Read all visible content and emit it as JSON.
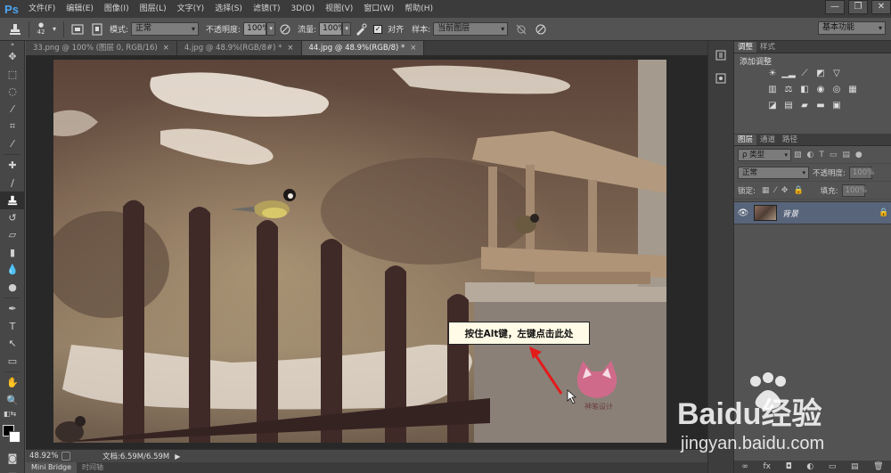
{
  "app": {
    "logo": "Ps",
    "menu": [
      "文件(F)",
      "编辑(E)",
      "图像(I)",
      "图层(L)",
      "文字(Y)",
      "选择(S)",
      "滤镜(T)",
      "3D(D)",
      "视图(V)",
      "窗口(W)",
      "帮助(H)"
    ],
    "window_controls": [
      "—",
      "❐",
      "✕"
    ]
  },
  "options": {
    "brush_size": "42",
    "mode_label": "模式:",
    "mode_value": "正常",
    "opacity_label": "不透明度:",
    "opacity_value": "100%",
    "flow_label": "流量:",
    "flow_value": "100%",
    "aligned_label": "对齐",
    "aligned_checked": "✓",
    "sample_label": "样本:",
    "sample_value": "当前图层",
    "workspace": "基本功能"
  },
  "tabs": [
    {
      "label": "33.png @ 100% (图层 0, RGB/16)",
      "close": "×"
    },
    {
      "label": "4.jpg @ 48.9%(RGB/8#) *",
      "close": "×"
    },
    {
      "label": "44.jpg @ 48.9%(RGB/8) *",
      "close": "×"
    }
  ],
  "tooltip": "按住Alt键，左键点击此处",
  "status": {
    "zoom": "48.92%",
    "doc": "文档:6.59M/6.59M",
    "arrow": "▶"
  },
  "mini_tabs": [
    "Mini Bridge",
    "时间轴"
  ],
  "panels": {
    "adjust_tabs": [
      "调整",
      "样式"
    ],
    "adjust_title": "添加调整",
    "layer_tabs": [
      "图层",
      "通道",
      "路径"
    ],
    "kind": "ρ 类型",
    "blend": "正常",
    "opacity_label": "不透明度:",
    "opacity_value": "100%",
    "lock_label": "锁定:",
    "fill_label": "填充:",
    "fill_value": "100%",
    "layer_name": "背景",
    "footer_icons": [
      "∞",
      "fx",
      "◘",
      "◐",
      "▭",
      "▤",
      "🗑"
    ]
  },
  "watermark": {
    "brand": "Baidu经验",
    "url": "jingyan.baidu.com"
  },
  "colors": {
    "accent": "#4ea4f0",
    "selected_layer": "#57647a",
    "tooltip_bg": "#fffbe6",
    "arrow": "#e21b1b"
  }
}
